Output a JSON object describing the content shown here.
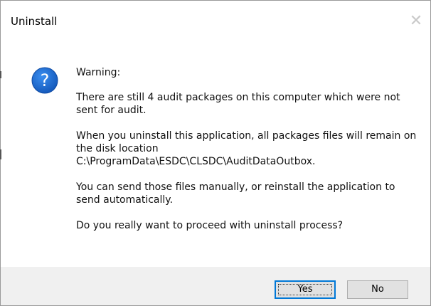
{
  "window": {
    "title": "Uninstall",
    "close_glyph": "✕"
  },
  "icon": {
    "name": "question-icon",
    "glyph": "?",
    "color": "#1f6fcf"
  },
  "message": {
    "heading": "Warning:",
    "line1": "There are still 4 audit packages on this computer which were not sent for audit.",
    "line2": "When you uninstall this application, all packages files will remain on the disk location",
    "path": "C:\\ProgramData\\ESDC\\CLSDC\\AuditDataOutbox.",
    "line3": "You can send those files manually, or reinstall the application to send automatically.",
    "question": "Do you really want to proceed with uninstall process?"
  },
  "buttons": {
    "yes_label": "Yes",
    "no_label": "No"
  },
  "colors": {
    "accent": "#0078d7",
    "footer_bg": "#f0f0f0",
    "button_bg": "#e1e1e1"
  }
}
